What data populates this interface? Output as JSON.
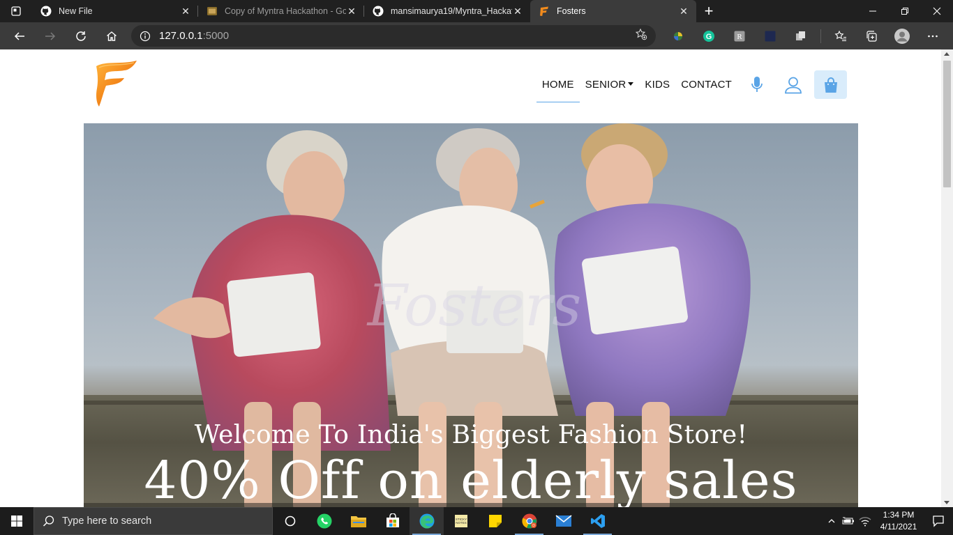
{
  "browser": {
    "tabs": [
      {
        "title": "New File",
        "active": false
      },
      {
        "title": "Copy of Myntra Hackathon - Goo",
        "active": false
      },
      {
        "title": "mansimaurya19/Myntra_Hackath",
        "active": false
      },
      {
        "title": "Fosters",
        "active": true
      }
    ],
    "address": {
      "host": "127.0.0.1",
      "port": ":5000"
    }
  },
  "site": {
    "nav": {
      "home": "HOME",
      "senior": "SENIOR",
      "kids": "KIDS",
      "contact": "CONTACT"
    },
    "hero": {
      "welcome": "Welcome To India's Biggest  Fashion Store!",
      "offer": "40% Off on elderly sales",
      "watermark": "Fosters"
    },
    "colors": {
      "accent": "#5aa4e6",
      "cart_bg": "#d9ecfb",
      "logo_orange": "#f08a1c"
    }
  },
  "taskbar": {
    "search_placeholder": "Type here to search",
    "time": "1:34 PM",
    "date": "4/11/2021"
  }
}
